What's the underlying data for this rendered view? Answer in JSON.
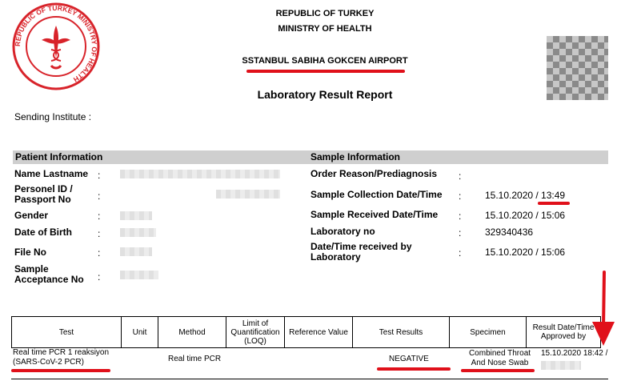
{
  "header": {
    "country": "REPUBLIC OF TURKEY",
    "ministry": "MINISTRY OF HEALTH",
    "location": "SSTANBUL SABIHA GOKCEN AIRPORT",
    "report_title": "Laboratory Result Report"
  },
  "seal": {
    "ring_text": "REPUBLIC OF TURKEY MINISTRY OF HEALTH"
  },
  "sending_institute": "Sending Institute :",
  "patient": {
    "heading": "Patient Information",
    "fields": [
      {
        "label": "Name Lastname"
      },
      {
        "label": "Personel ID / Passport No"
      },
      {
        "label": "Gender"
      },
      {
        "label": "Date of Birth"
      },
      {
        "label": "File No"
      },
      {
        "label": "Sample Acceptance No"
      }
    ]
  },
  "sample": {
    "heading": "Sample Information",
    "fields": [
      {
        "label": "Order Reason/Prediagnosis",
        "value": ""
      },
      {
        "label": "Sample Collection Date/Time",
        "value": "15.10.2020 / 13:49"
      },
      {
        "label": "Sample Received Date/Time",
        "value": "15.10.2020 / 15:06"
      },
      {
        "label": "Laboratory no",
        "value": "329340436"
      },
      {
        "label": "Date/Time received by Laboratory",
        "value": "15.10.2020 / 15:06"
      }
    ]
  },
  "colon": ":",
  "results_table": {
    "headers": [
      "Test",
      "Unit",
      "Method",
      "Limit of Quantification (LOQ)",
      "Reference Value",
      "Test Results",
      "Specimen",
      "Result Date/Time Approved by"
    ],
    "row": {
      "test": "Real time PCR 1 reaksiyon (SARS-CoV-2 PCR)",
      "unit": "",
      "method": "Real time PCR",
      "loq": "",
      "reference": "",
      "result": "NEGATIVE",
      "specimen": "Combined Throat And Nose Swab",
      "result_datetime": "15.10.2020 18:42 /"
    }
  },
  "colors": {
    "annotation_red": "#e0101a",
    "seal_red": "#d8232a",
    "band_gray": "#cfcfcf"
  }
}
